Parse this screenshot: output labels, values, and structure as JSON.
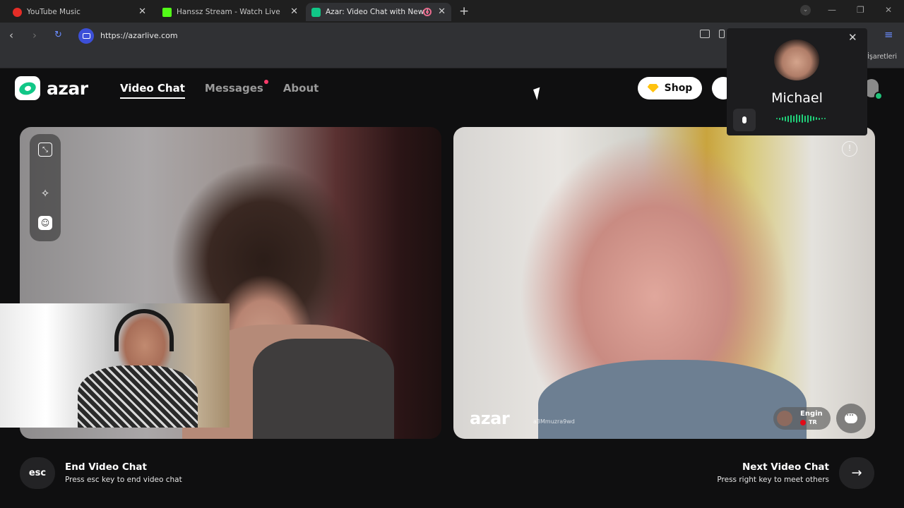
{
  "browser": {
    "tabs": [
      {
        "title": "YouTube Music",
        "active": false,
        "favicon_color": "#e52d27"
      },
      {
        "title": "Hanssz Stream - Watch Live on Kick",
        "active": false,
        "favicon_color": "#53fc18"
      },
      {
        "title": "Azar: Video Chat with New Friends",
        "active": true,
        "favicon_color": "#11c787"
      }
    ],
    "new_tab_symbol": "+",
    "url": "https://azarlive.com",
    "bookmarks_label": "İşaretleri"
  },
  "header": {
    "logo_text": "azar",
    "nav": [
      {
        "label": "Video Chat",
        "active": true,
        "has_dot": false
      },
      {
        "label": "Messages",
        "active": false,
        "has_dot": true
      },
      {
        "label": "About",
        "active": false,
        "has_dot": false
      }
    ],
    "shop_label": "Shop"
  },
  "call_card": {
    "name": "Michael",
    "close_symbol": "✕"
  },
  "partner": {
    "watermark": "azar",
    "user_id": "a3Mmuzra9wd",
    "name": "Engin",
    "country": "TR"
  },
  "controls": {
    "esc_label": "esc",
    "end_title": "End Video Chat",
    "end_subtitle": "Press esc key to end video chat",
    "next_title": "Next Video Chat",
    "next_subtitle": "Press right key to meet others",
    "next_symbol": "→"
  },
  "colors": {
    "brand": "#11c787",
    "notification_dot": "#ff3b6b",
    "audio_wave": "#21d07a",
    "gem": "#ffc20e"
  }
}
